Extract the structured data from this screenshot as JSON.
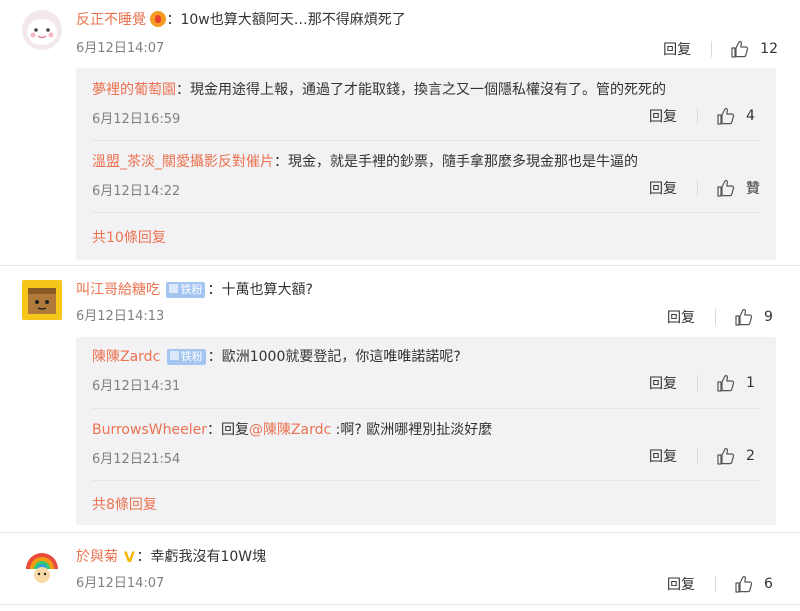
{
  "reply_label": "回复",
  "comments": [
    {
      "user": "反正不睡覺",
      "emoji": "fire-emoji",
      "text": "：10w也算大額阿天…那不得麻煩死了",
      "date": "6月12日14:07",
      "likes": "12",
      "replies": [
        {
          "user": "夢裡的葡萄園",
          "text": "：現金用途得上報，通過了才能取錢，換言之又一個隱私權沒有了。管的死死的",
          "date": "6月12日16:59",
          "likes": "4"
        },
        {
          "user": "溫盟_茶淡_關愛攝影反對催片",
          "text": "：現金，就是手裡的鈔票，隨手拿那麼多現金那也是牛逼的",
          "date": "6月12日14:22",
          "likes": "贊"
        }
      ],
      "more": "共10條回复"
    },
    {
      "user": "叫江哥給糖吃",
      "badge": "铁粉",
      "text": "：十萬也算大額?",
      "date": "6月12日14:13",
      "likes": "9",
      "replies": [
        {
          "user": "陳陳Zardc",
          "badge": "铁粉",
          "text": "：歐洲1000就要登記，你這唯唯諾諾呢?",
          "date": "6月12日14:31",
          "likes": "1"
        },
        {
          "user": "BurrowsWheeler",
          "prefix": "：回复",
          "mention": "@陳陳Zardc",
          "text": " :啊? 歐洲哪裡別扯淡好麼",
          "date": "6月12日21:54",
          "likes": "2"
        }
      ],
      "more": "共8條回复"
    },
    {
      "user": "於與菊",
      "verified": "V",
      "text": "：幸虧我沒有10W塊",
      "date": "6月12日14:07",
      "likes": "6"
    }
  ],
  "colors": {
    "accent": "#eb7350",
    "subbox": "#f2f2f5",
    "meta": "#808080",
    "badge": "#a3c5f0",
    "verified": "#f8b400"
  }
}
